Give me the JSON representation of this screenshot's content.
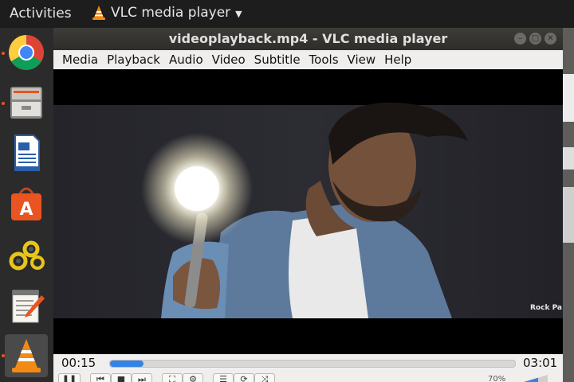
{
  "topbar": {
    "activities_label": "Activities",
    "app_menu_label": "VLC media player"
  },
  "dock": {
    "items": [
      "chrome-icon",
      "file-manager-icon",
      "writer-icon",
      "software-center-icon",
      "settings-icon",
      "text-editor-icon",
      "vlc-icon"
    ]
  },
  "window": {
    "title": "videoplayback.mp4 - VLC media player"
  },
  "menu": {
    "items": [
      "Media",
      "Playback",
      "Audio",
      "Video",
      "Subtitle",
      "Tools",
      "View",
      "Help"
    ]
  },
  "player": {
    "time_elapsed": "00:15",
    "time_total": "03:01",
    "progress": 0.083,
    "volume_label": "70%",
    "watermark": "Rock Pa"
  },
  "colors": {
    "accent": "#3584e4",
    "dock_indicator": "#e95420"
  }
}
